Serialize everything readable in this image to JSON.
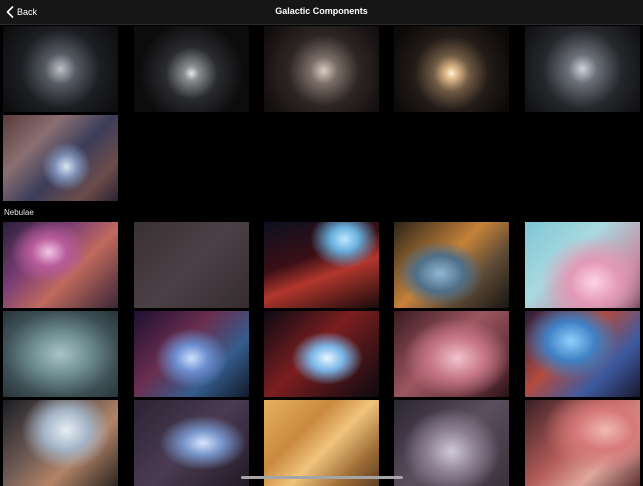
{
  "header": {
    "back_label": "Back",
    "title": "Galactic Components"
  },
  "icons": {
    "back": "chevron-left-icon"
  },
  "sections": [
    {
      "label": "",
      "thumbnail_count": 6,
      "subject": "star clusters"
    },
    {
      "label": "Nebulae",
      "thumbnail_count": 15,
      "subject": "nebulae"
    }
  ],
  "colors": {
    "background": "#000000",
    "navbar": "#161616",
    "text": "#ffffff"
  }
}
